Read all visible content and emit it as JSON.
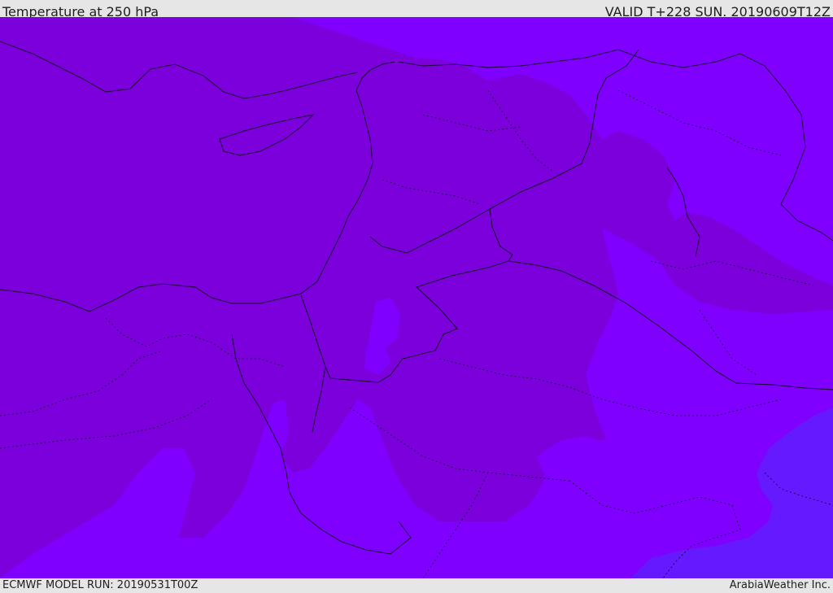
{
  "header": {
    "title": "Temperature at 250 hPa",
    "valid_time": "VALID T+228 SUN. 20190609T12Z"
  },
  "footer": {
    "model_run": "ECMWF MODEL RUN: 20190531T00Z",
    "credit": "ArabiaWeather Inc."
  },
  "map": {
    "colors": {
      "warmer_band": "#7b00db",
      "mid_band": "#7f00ff",
      "cooler_band": "#6519ff",
      "coastline": "#1a0033",
      "border": "#120028"
    }
  }
}
